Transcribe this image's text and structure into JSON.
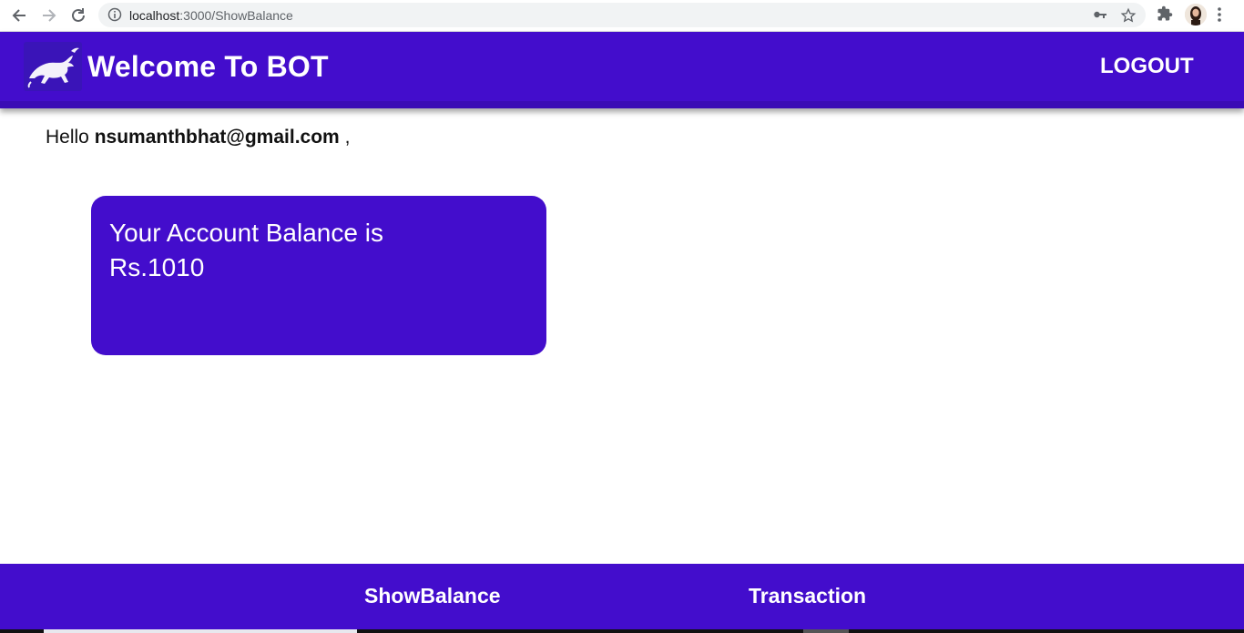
{
  "browser": {
    "url_host": "localhost",
    "url_rest": ":3000/ShowBalance"
  },
  "header": {
    "title": "Welcome To BOT",
    "logout_label": "LOGOUT"
  },
  "main": {
    "greeting_prefix": "Hello",
    "user_email": "nsumanthbhat@gmail.com",
    "greeting_suffix": ",",
    "balance_label": "Your Account Balance is",
    "balance_amount": "Rs.1010"
  },
  "footer": {
    "links": [
      "ShowBalance",
      "Transaction"
    ]
  },
  "colors": {
    "brand": "#430dcc"
  }
}
